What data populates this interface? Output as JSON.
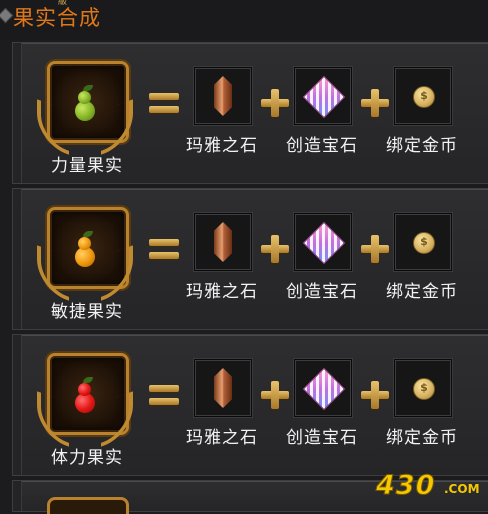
{
  "header": {
    "title": "果实合成",
    "tiny": "級"
  },
  "recipes": [
    {
      "product": "力量果实",
      "fruit_color": "#8ab82a",
      "fruit_dark": "#4a7a10",
      "ingredients": [
        "玛雅之石",
        "创造宝石",
        "绑定金币"
      ]
    },
    {
      "product": "敏捷果实",
      "fruit_color": "#f09a10",
      "fruit_dark": "#b05a00",
      "ingredients": [
        "玛雅之石",
        "创造宝石",
        "绑定金币"
      ]
    },
    {
      "product": "体力果实",
      "fruit_color": "#e81818",
      "fruit_dark": "#8a0808",
      "ingredients": [
        "玛雅之石",
        "创造宝石",
        "绑定金币"
      ]
    }
  ],
  "icons": {
    "coin_symbol": "$"
  },
  "watermark": {
    "main": "430",
    "suffix": ".COM"
  }
}
